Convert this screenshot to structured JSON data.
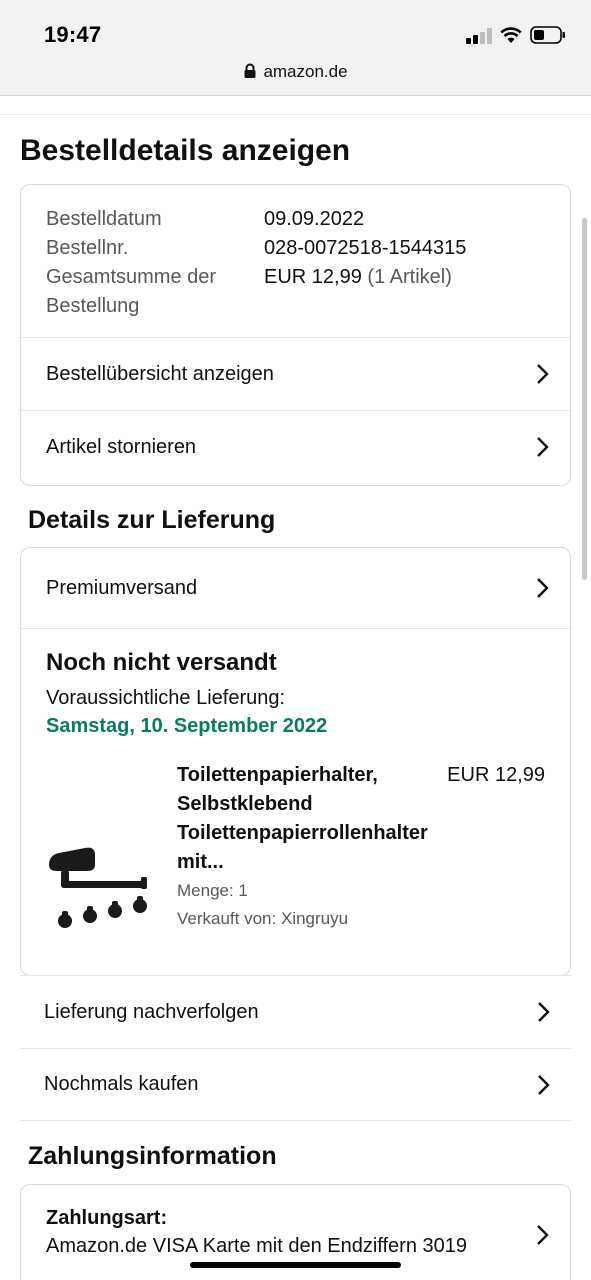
{
  "status_bar": {
    "time": "19:47"
  },
  "browser": {
    "url": "amazon.de"
  },
  "page": {
    "title": "Bestelldetails anzeigen"
  },
  "order_info": {
    "date_label": "Bestelldatum",
    "date_value": "09.09.2022",
    "number_label": "Bestellnr.",
    "number_value": "028-0072518-1544315",
    "total_label_line1": "Gesamtsumme der",
    "total_label_line2": "Bestellung",
    "total_value": "EUR 12,99",
    "total_items": "(1 Artikel)"
  },
  "order_links": [
    {
      "label": "Bestellübersicht anzeigen"
    },
    {
      "label": "Artikel stornieren"
    }
  ],
  "delivery": {
    "section_title": "Details zur Lieferung",
    "shipping_method": "Premiumversand",
    "status": "Noch nicht versandt",
    "expected_label": "Voraussichtliche Lieferung:",
    "expected_date": "Samstag, 10. September 2022",
    "item": {
      "title_line1": "Toilettenpapierhalter,",
      "title_line2": "Selbstklebend",
      "title_line3": "Toilettenpapierrollenhalter",
      "title_line4": "mit...",
      "price": "EUR 12,99",
      "quantity": "Menge: 1",
      "seller": "Verkauft von: Xingruyu"
    }
  },
  "actions": [
    {
      "label": "Lieferung nachverfolgen"
    },
    {
      "label": "Nochmals kaufen"
    }
  ],
  "payment": {
    "section_title": "Zahlungsinformation",
    "method_label": "Zahlungsart:",
    "method_value": "Amazon.de VISA Karte mit den Endziffern 3019"
  },
  "colors": {
    "delivery_green": "#067d62",
    "border": "#d5d9d9",
    "muted_text": "#565959"
  }
}
